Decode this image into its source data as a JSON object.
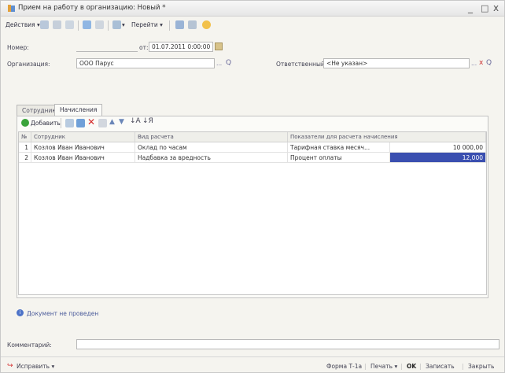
{
  "window": {
    "title": "Прием на работу в организацию: Новый *",
    "minimize": "_",
    "restore": "□",
    "close": "x"
  },
  "toolbar": {
    "actions": "Действия",
    "goto": "Перейти"
  },
  "header": {
    "number_label": "Номер:",
    "number_value": "",
    "date_from": "от:",
    "date_value": "01.07.2011 0:00:00",
    "org_label": "Организация:",
    "org_value": "ООО Парус",
    "resp_label": "Ответственный:",
    "resp_value": "<Не указан>"
  },
  "tabs": [
    {
      "label": "Сотрудники"
    },
    {
      "label": "Начисления"
    }
  ],
  "grid_toolbar": {
    "add": "Добавить"
  },
  "table": {
    "columns": [
      "№",
      "Сотрудник",
      "Вид расчета",
      "Показатели для расчета начисления"
    ],
    "rows": [
      {
        "n": "1",
        "employee": "Козлов Иван Иванович",
        "calc": "Оклад по часам",
        "indicator": "Тарифная ставка месяч...",
        "value": "10 000,00"
      },
      {
        "n": "2",
        "employee": "Козлов Иван Иванович",
        "calc": "Надбавка за вредность",
        "indicator": "Процент оплаты",
        "value": "12,000"
      }
    ]
  },
  "status": "Документ не проведен",
  "comment_label": "Комментарий:",
  "comment_value": "",
  "footer": {
    "fix": "Исправить",
    "form": "Форма Т-1а",
    "print": "Печать",
    "ok": "OK",
    "save": "Записать",
    "close": "Закрыть"
  },
  "colors": {
    "selection": "#3a4fb0",
    "accent_green": "#3aa33a",
    "delete_red": "#d42a2a"
  }
}
